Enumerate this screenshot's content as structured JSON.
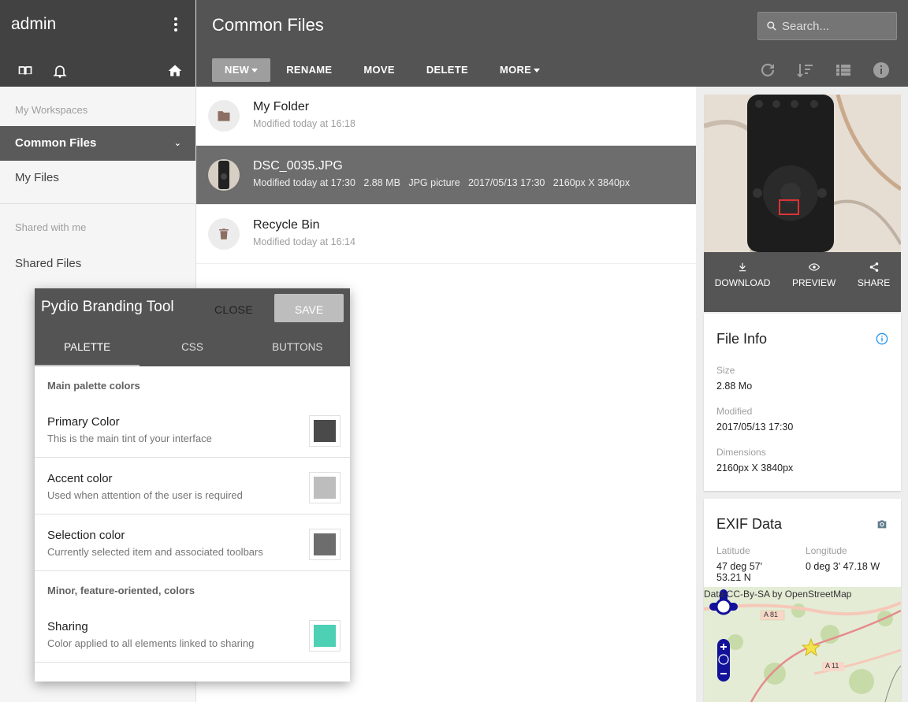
{
  "sidebar": {
    "user": "admin",
    "sections": [
      {
        "label": "My Workspaces",
        "items": [
          {
            "label": "Common Files",
            "active": true
          },
          {
            "label": "My Files",
            "active": false
          }
        ]
      },
      {
        "label": "Shared with me",
        "items": [
          {
            "label": "Shared Files",
            "active": false
          }
        ]
      }
    ]
  },
  "header": {
    "title": "Common Files",
    "search_placeholder": "Search...",
    "toolbar": {
      "new": "NEW",
      "rename": "RENAME",
      "move": "MOVE",
      "delete": "DELETE",
      "more": "MORE"
    }
  },
  "files": [
    {
      "name": "My Folder",
      "meta": "Modified today at 16:18",
      "icon": "folder-icon",
      "selected": false
    },
    {
      "name": "DSC_0035.JPG",
      "meta": "Modified today at 17:30   2.88 MB   JPG picture   2017/05/13 17:30   2160px X 3840px",
      "icon": "image-thumb",
      "selected": true
    },
    {
      "name": "Recycle Bin",
      "meta": "Modified today at 16:14",
      "icon": "trash-icon",
      "selected": false
    }
  ],
  "preview_actions": {
    "download": "DOWNLOAD",
    "preview": "PREVIEW",
    "share": "SHARE"
  },
  "file_info": {
    "title": "File Info",
    "size_label": "Size",
    "size": "2.88 Mo",
    "modified_label": "Modified",
    "modified": "2017/05/13 17:30",
    "dimensions_label": "Dimensions",
    "dimensions": "2160px X 3840px"
  },
  "exif": {
    "title": "EXIF Data",
    "lat_label": "Latitude",
    "lat": "47 deg 57' 53.21 N",
    "lon_label": "Longitude",
    "lon": "0 deg 3' 47.18 W",
    "map_credit": "Data CC-By-SA by OpenStreetMap",
    "road1": "A 81",
    "road2": "A 11"
  },
  "branding_dialog": {
    "title": "Pydio Branding Tool",
    "close": "CLOSE",
    "save": "SAVE",
    "tabs": [
      "PALETTE",
      "CSS",
      "BUTTONS"
    ],
    "main_section": "Main palette colors",
    "minor_section": "Minor, feature-oriented, colors",
    "colors": [
      {
        "name": "Primary Color",
        "desc": "This is the main tint of your interface",
        "value": "#4a4a4a"
      },
      {
        "name": "Accent color",
        "desc": "Used when attention of the user is required",
        "value": "#bdbdbd"
      },
      {
        "name": "Selection color",
        "desc": "Currently selected item and associated toolbars",
        "value": "#6d6d6d"
      },
      {
        "name": "Sharing",
        "desc": "Color applied to all elements linked to sharing",
        "value": "#4dd0b4"
      }
    ]
  }
}
